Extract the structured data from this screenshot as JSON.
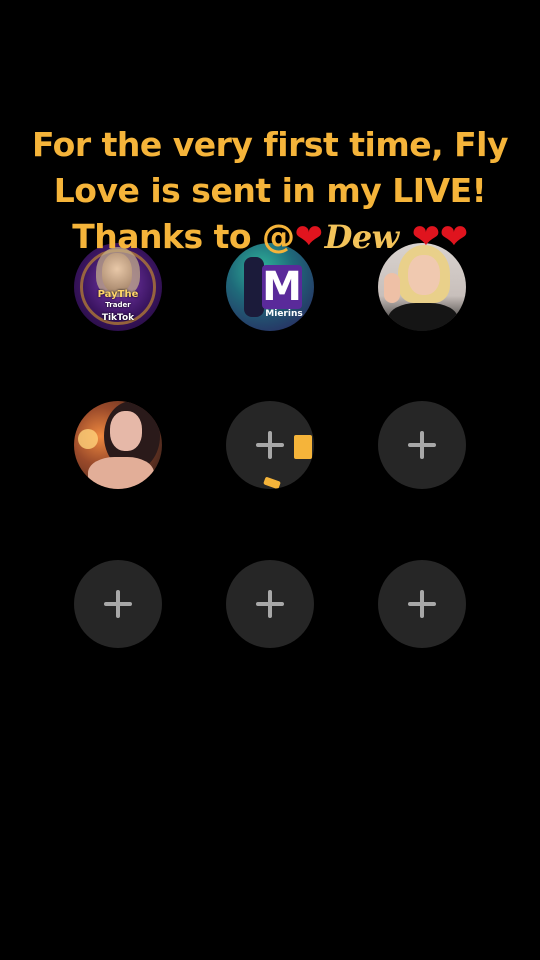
{
  "banner": {
    "line1": "For the very first time, Fly",
    "line2": "Love is sent in my LIVE!",
    "line3_prefix": "Thanks to @",
    "line3_name": "Dew",
    "heart": "❤"
  },
  "avatars": [
    {
      "name": "avatar-paythetrader",
      "text_top": "PayThe",
      "text_mid": "Trader",
      "text_bot": "TikTok"
    },
    {
      "name": "avatar-mierins",
      "letter": "M",
      "label": "Mierins"
    },
    {
      "name": "avatar-blonde-woman"
    },
    {
      "name": "avatar-dark-hair-woman"
    }
  ],
  "empty_slot_icon": "plus-icon",
  "colors": {
    "banner_text": "#f5b43a",
    "heart": "#e0141e",
    "background": "#000000",
    "empty_slot": "#262626",
    "plus": "#a8a8a8"
  }
}
